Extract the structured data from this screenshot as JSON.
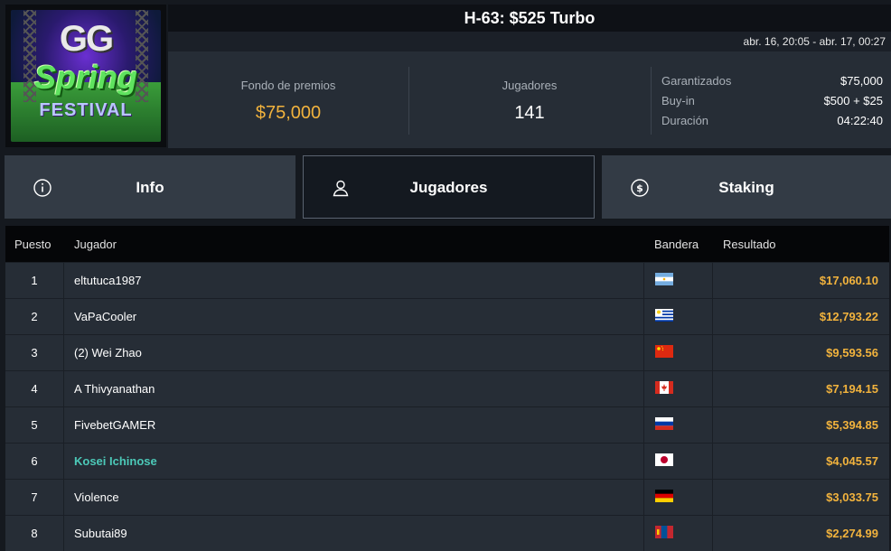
{
  "tournament": {
    "title": "H-63: $525 Turbo",
    "dates": "abr. 16, 20:05 - abr. 17, 00:27",
    "logo_text": {
      "line1": "GG",
      "line2": "Spring",
      "line3": "FESTIVAL"
    }
  },
  "stats": {
    "prize_label": "Fondo de premios",
    "prize_value": "$75,000",
    "players_label": "Jugadores",
    "players_value": "141",
    "details": [
      {
        "label": "Garantizados",
        "value": "$75,000"
      },
      {
        "label": "Buy-in",
        "value": "$500 + $25"
      },
      {
        "label": "Duración",
        "value": "04:22:40"
      }
    ]
  },
  "tabs": [
    {
      "label": "Info",
      "icon": "info-icon"
    },
    {
      "label": "Jugadores",
      "icon": "user-icon",
      "active": true
    },
    {
      "label": "Staking",
      "icon": "dollar-coin-icon"
    }
  ],
  "table": {
    "headers": {
      "pos": "Puesto",
      "player": "Jugador",
      "flag": "Bandera",
      "result": "Resultado"
    },
    "rows": [
      {
        "pos": "1",
        "player": "eltutuca1987",
        "flag": "Argentina",
        "result": "$17,060.10"
      },
      {
        "pos": "2",
        "player": "VaPaCooler",
        "flag": "Uruguay",
        "result": "$12,793.22"
      },
      {
        "pos": "3",
        "player": "(2) Wei Zhao",
        "flag": "China",
        "result": "$9,593.56"
      },
      {
        "pos": "4",
        "player": "A Thivyanathan",
        "flag": "Canada",
        "result": "$7,194.15"
      },
      {
        "pos": "5",
        "player": "FivebetGAMER",
        "flag": "Russia",
        "result": "$5,394.85"
      },
      {
        "pos": "6",
        "player": "Kosei Ichinose",
        "flag": "Japan",
        "result": "$4,045.57",
        "highlight": true
      },
      {
        "pos": "7",
        "player": "Violence",
        "flag": "Germany",
        "result": "$3,033.75"
      },
      {
        "pos": "8",
        "player": "Subutai89",
        "flag": "Mongolia",
        "result": "$2,274.99"
      }
    ]
  },
  "colors": {
    "accent_gold": "#f2b33d",
    "highlight_teal": "#4cc9b8"
  }
}
